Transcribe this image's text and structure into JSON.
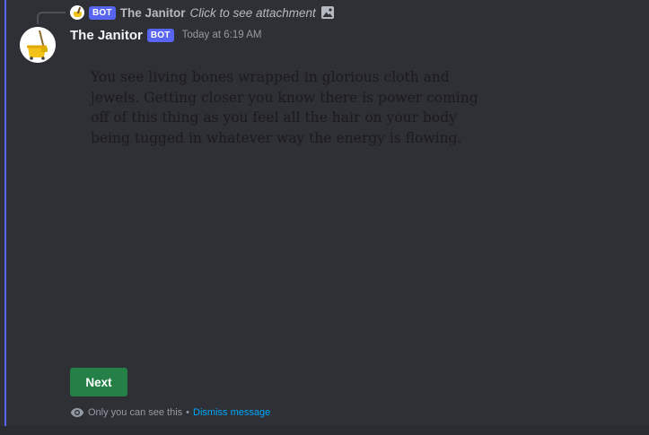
{
  "reply": {
    "bot_tag": "BOT",
    "author": "The Janitor",
    "text": "Click to see attachment",
    "attachment_icon": "image-icon"
  },
  "message": {
    "author": "The Janitor",
    "bot_tag": "BOT",
    "timestamp": "Today at 6:19 AM",
    "text": "You see living bones wrapped in glorious cloth and jewels. Getting closer you know there is power coming off of this thing as you feel all the hair on your body being tugged in whatever way the energy is flowing."
  },
  "button": {
    "label": "Next",
    "color": "#248046"
  },
  "notice": {
    "icon": "eye-icon",
    "text": "Only you can see this",
    "separator": "•",
    "dismiss": "Dismiss message"
  },
  "colors": {
    "background": "#2f3035",
    "accent": "#5865f2",
    "link": "#00a8fc"
  }
}
